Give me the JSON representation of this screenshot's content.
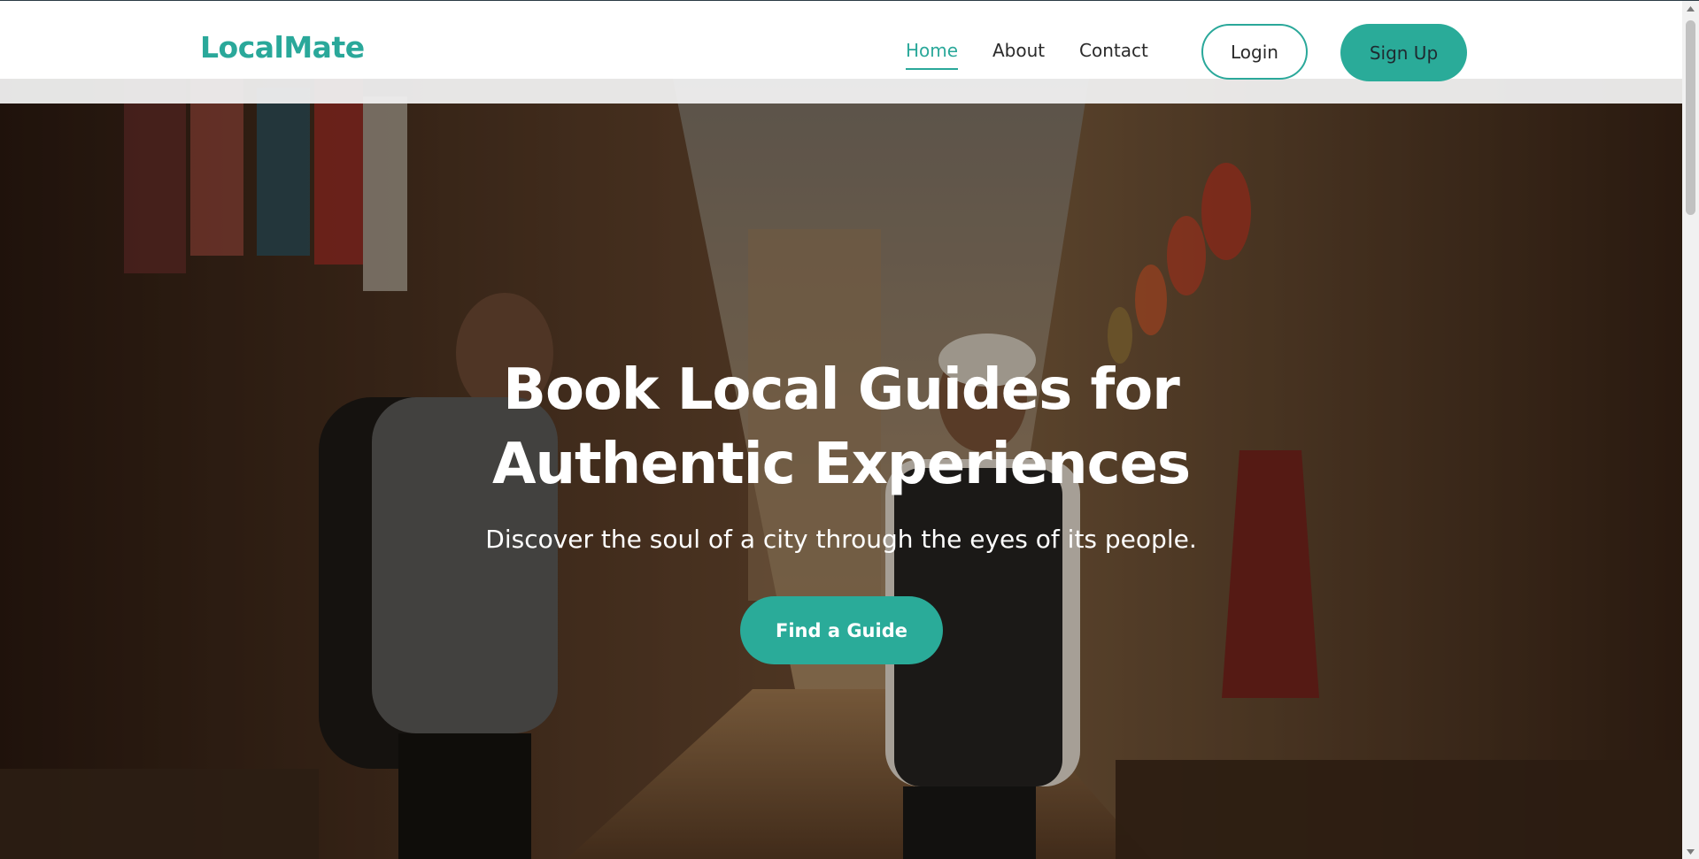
{
  "brand": {
    "name": "LocalMate",
    "color": "#2aa89a"
  },
  "nav": {
    "items": [
      {
        "label": "Home",
        "active": true
      },
      {
        "label": "About",
        "active": false
      },
      {
        "label": "Contact",
        "active": false
      }
    ],
    "login_label": "Login",
    "signup_label": "Sign Up"
  },
  "hero": {
    "title_line1": "Book Local Guides for",
    "title_line2": "Authentic Experiences",
    "subtitle": "Discover the soul of a city through the eyes of its people.",
    "cta_label": "Find a Guide",
    "image": "photo-of-traveler-with-local-guide-in-market-street"
  },
  "colors": {
    "accent": "#2aab99",
    "nav_text": "#2a2a2a",
    "hero_text": "#ffffff"
  },
  "icons": {
    "scroll_up": "triangle-up",
    "scroll_down": "triangle-down"
  }
}
